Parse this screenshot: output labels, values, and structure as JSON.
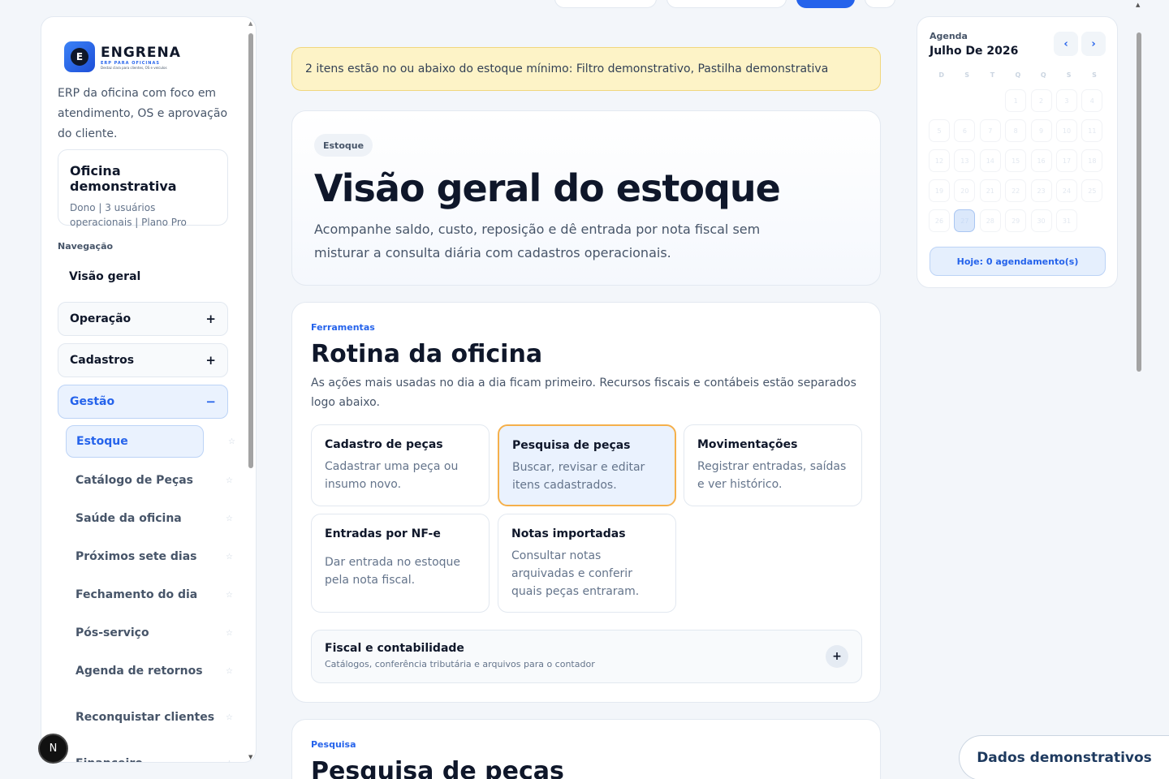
{
  "brand": {
    "name": "ENGRENA",
    "tagline": "ERP PARA OFICINAS",
    "tiny": "Destaz clara para clientes, OS e veículos",
    "logo_letter": "E",
    "description": "ERP da oficina com foco em atendimento, OS e aprovação do cliente."
  },
  "org": {
    "name": "Oficina demonstrativa",
    "meta": "Dono | 3 usuários operacionais | Plano Pro"
  },
  "nav": {
    "label": "Navegação",
    "home": "Visão geral",
    "groups": [
      {
        "label": "Operação",
        "symbol": "+"
      },
      {
        "label": "Cadastros",
        "symbol": "+"
      },
      {
        "label": "Gestão",
        "symbol": "−"
      }
    ],
    "sub_items": [
      {
        "label": "Estoque"
      },
      {
        "label": "Catálogo de Peças"
      },
      {
        "label": "Saúde da oficina"
      },
      {
        "label": "Próximos sete dias"
      },
      {
        "label": "Fechamento do dia"
      },
      {
        "label": "Pós-serviço"
      },
      {
        "label": "Agenda de retornos"
      },
      {
        "label": "Reconquistar clientes"
      },
      {
        "label": "Financeiro"
      }
    ],
    "star": "☆"
  },
  "alert": "2 itens estão no ou abaixo do estoque mínimo: Filtro demonstrativo, Pastilha demonstrativa",
  "hero": {
    "chip": "Estoque",
    "title": "Visão geral do estoque",
    "subtitle": "Acompanhe saldo, custo, reposição e dê entrada por nota fiscal sem misturar a consulta diária com cadastros operacionais."
  },
  "tools": {
    "eyebrow": "Ferramentas",
    "title": "Rotina da oficina",
    "description": "As ações mais usadas no dia a dia ficam primeiro. Recursos fiscais e contábeis estão separados logo abaixo.",
    "tiles": [
      {
        "title": "Cadastro de peças",
        "desc": "Cadastrar uma peça ou insumo novo."
      },
      {
        "title": "Pesquisa de peças",
        "desc": "Buscar, revisar e editar itens cadastrados."
      },
      {
        "title": "Movimentações",
        "desc": "Registrar entradas, saídas e ver histórico."
      },
      {
        "title": "Entradas por NF-e",
        "desc": "Dar entrada no estoque pela nota fiscal."
      },
      {
        "title": "Notas importadas",
        "desc": "Consultar notas arquivadas e conferir quais peças entraram."
      }
    ],
    "fiscal": {
      "title": "Fiscal e contabilidade",
      "desc": "Catálogos, conferência tributária e arquivos para o contador",
      "symbol": "+"
    }
  },
  "search": {
    "eyebrow": "Pesquisa",
    "title": "Pesquisa de peças"
  },
  "calendar": {
    "label": "Agenda",
    "month": "Julho De 2026",
    "prev": "‹",
    "next": "›",
    "weekdays": [
      "D",
      "S",
      "T",
      "Q",
      "Q",
      "S",
      "S"
    ],
    "weeks": [
      [
        "",
        "",
        "",
        "1",
        "2",
        "3",
        "4"
      ],
      [
        "5",
        "6",
        "7",
        "8",
        "9",
        "10",
        "11"
      ],
      [
        "12",
        "13",
        "14",
        "15",
        "16",
        "17",
        "18"
      ],
      [
        "19",
        "20",
        "21",
        "22",
        "23",
        "24",
        "25"
      ],
      [
        "26",
        "27",
        "28",
        "29",
        "30",
        "31",
        ""
      ]
    ],
    "today": "27",
    "today_button": "Hoje: 0 agendamento(s)"
  },
  "demo_badge": "Dados demonstrativos",
  "assistant_letter": "N",
  "colors": {
    "accent": "#2563eb",
    "alert_bg": "#fdf3c7",
    "selected_border": "#f5b04b"
  }
}
